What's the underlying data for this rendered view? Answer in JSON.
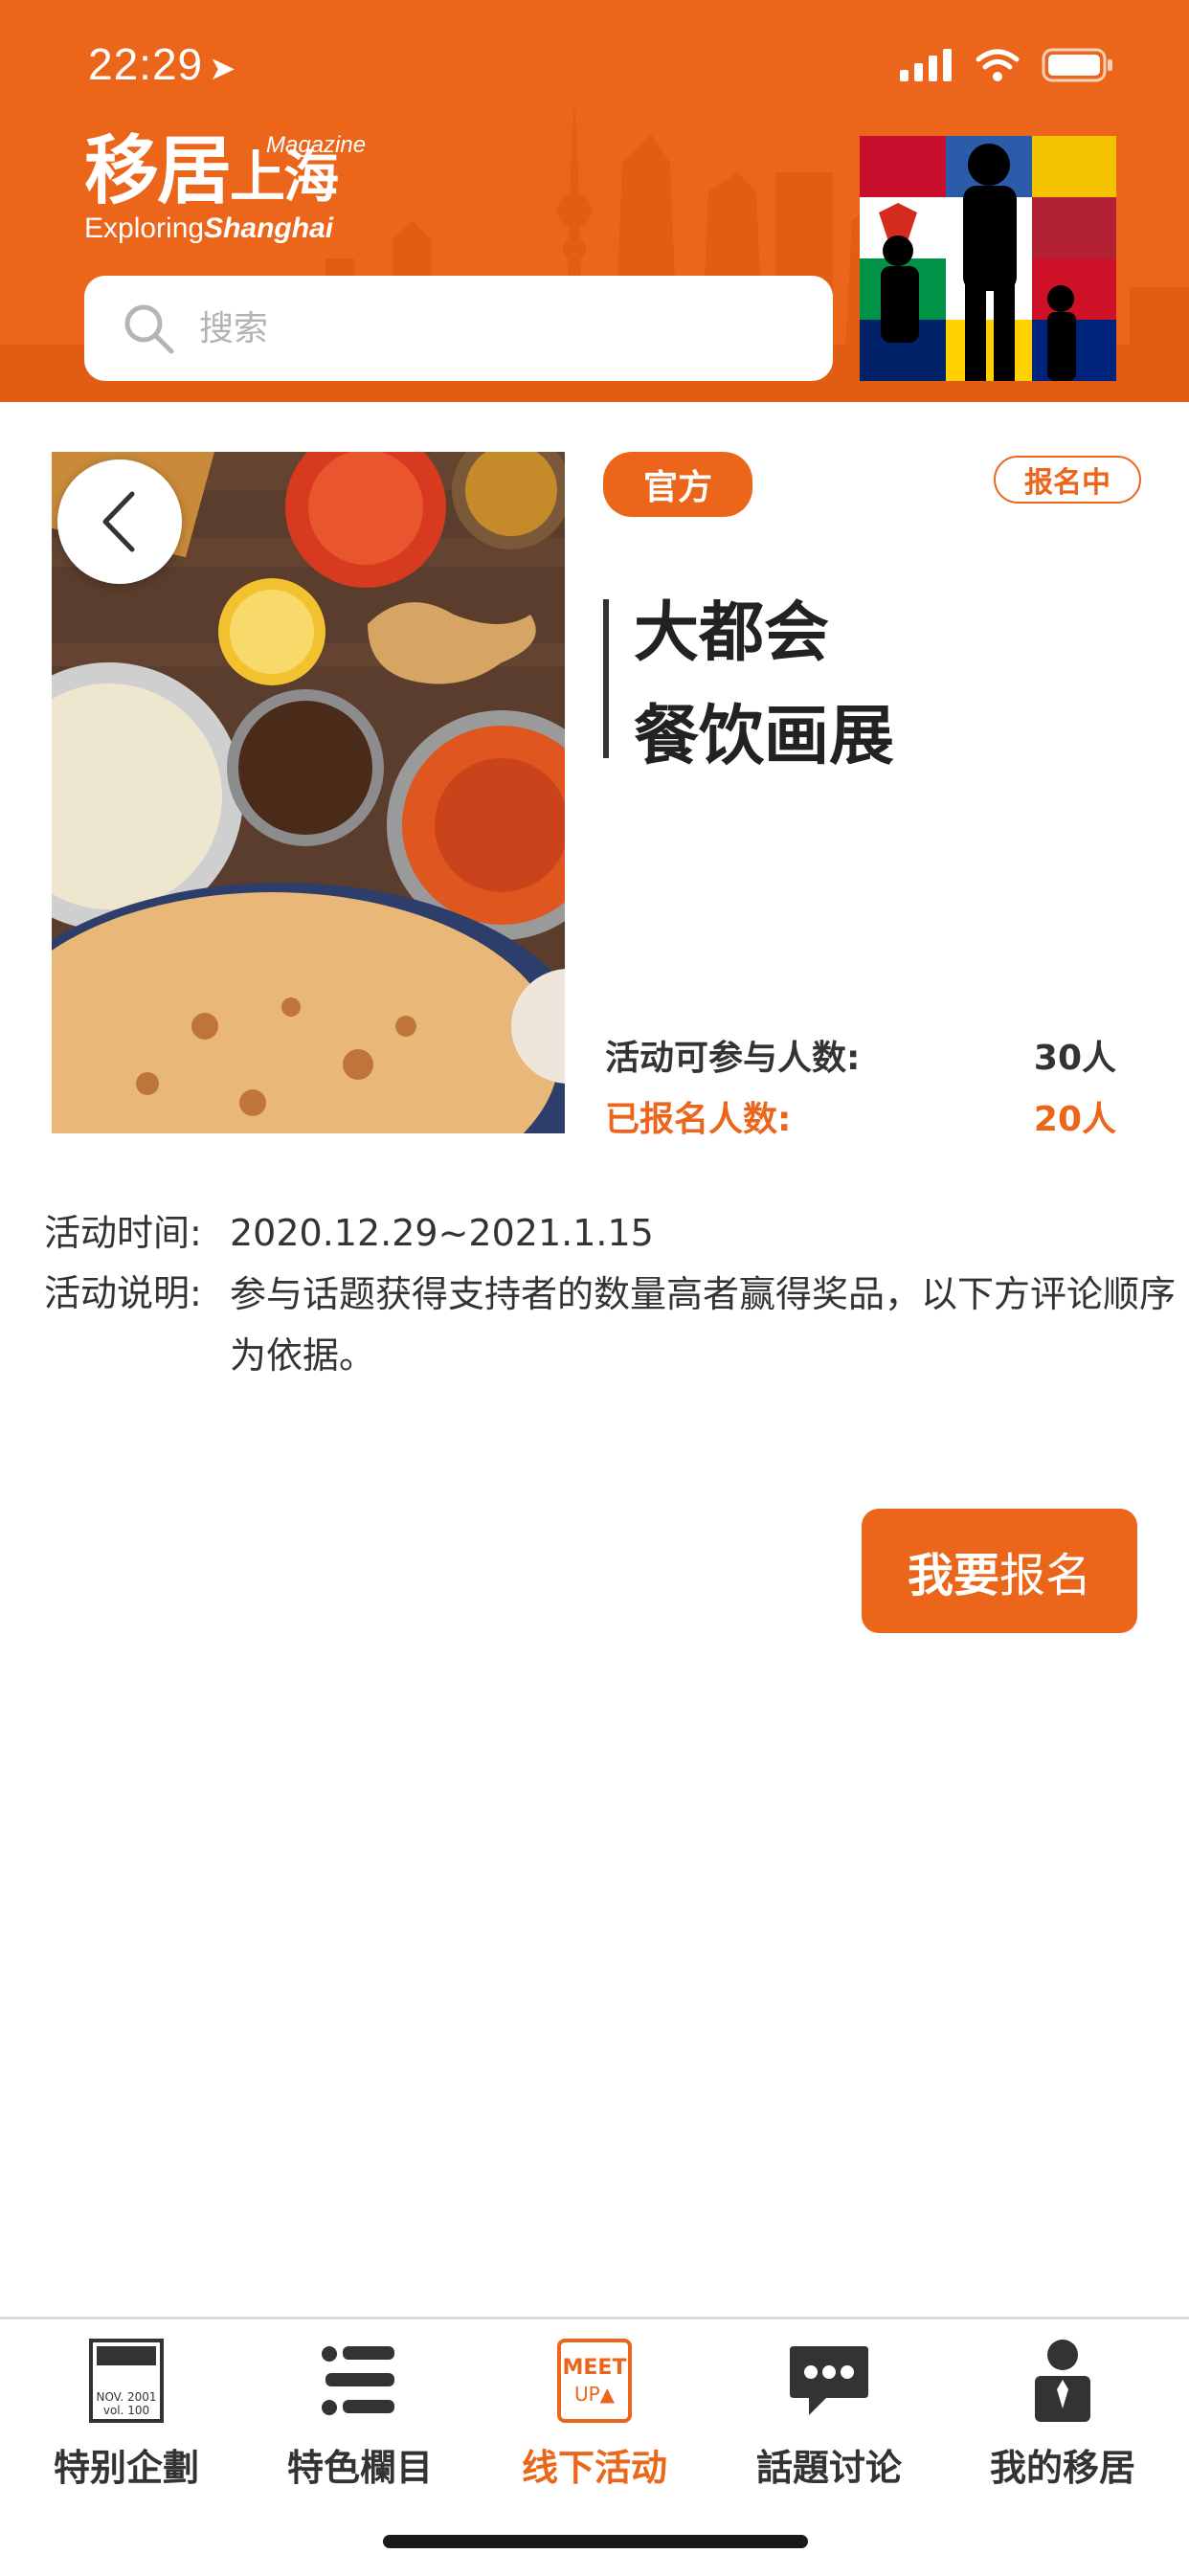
{
  "status_bar": {
    "time": "22:29"
  },
  "header": {
    "logo_cn_1": "移居",
    "logo_cn_2": "上海",
    "logo_magazine": "Magazine",
    "logo_en_1": "Exploring",
    "logo_en_2": "Shanghai",
    "search_placeholder": "搜索"
  },
  "event": {
    "tag": "官方",
    "status": "报名中",
    "title_line1": "大都会",
    "title_line2": "餐饮画展",
    "capacity_label": "活动可参与人数:",
    "capacity_value": "30人",
    "registered_label": "已报名人数:",
    "registered_value": "20人",
    "time_label": "活动时间:",
    "time_value": "2020.12.29~2021.1.15",
    "desc_label": "活动说明:",
    "desc_value": "参与话题获得支持者的数量高者赢得奖品，以下方评论顺序为依据。",
    "signup_bold": "我要",
    "signup_light": "报名"
  },
  "tabbar": {
    "items": [
      {
        "label": "特别企劃",
        "icon": "magazine-cover-icon"
      },
      {
        "label": "特色欄目",
        "icon": "list-icon"
      },
      {
        "label": "线下活动",
        "icon": "meetup-icon",
        "active": true
      },
      {
        "label": "話題讨论",
        "icon": "chat-bubble-icon"
      },
      {
        "label": "我的移居",
        "icon": "user-icon"
      }
    ],
    "magazine_icon_text": {
      "date": "NOV. 2001",
      "vol": "vol. 100"
    },
    "meetup_icon_text": {
      "line1": "MEET",
      "line2": "UP▲"
    }
  },
  "colors": {
    "accent": "#eb661a",
    "text": "#333333"
  }
}
